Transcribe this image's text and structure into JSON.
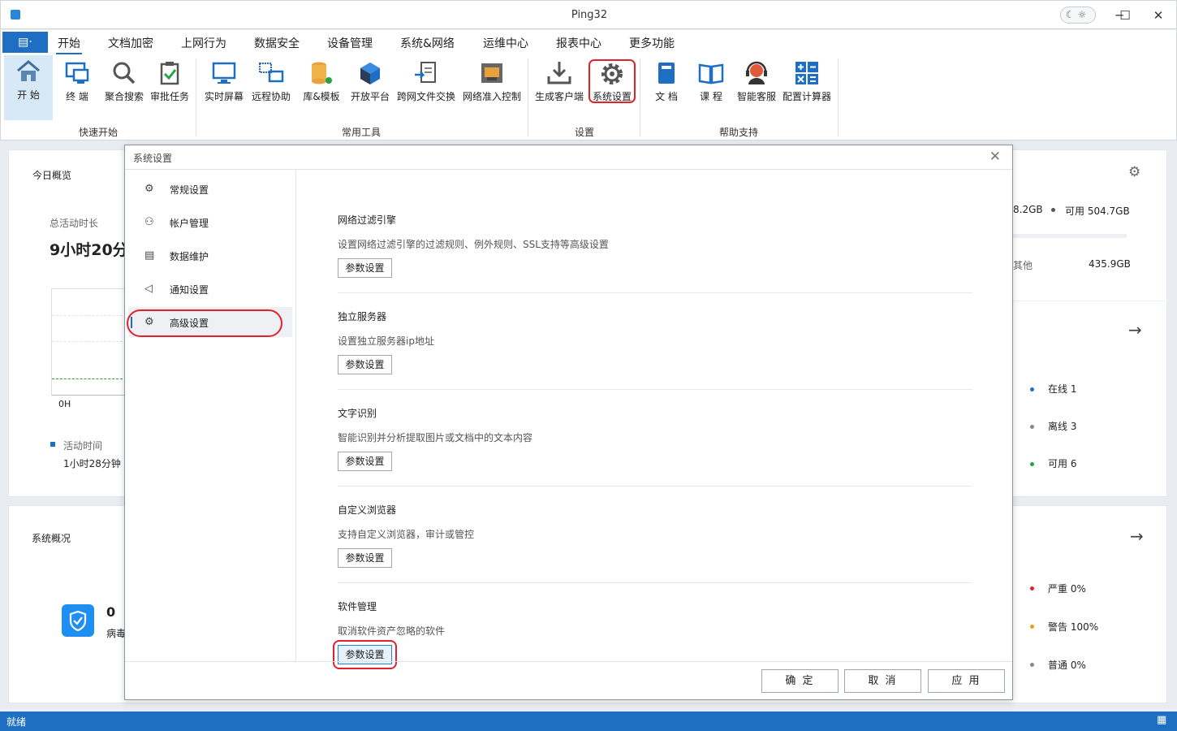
{
  "window": {
    "title": "Ping32",
    "theme_icons": "☾ ☼",
    "minimize": "─",
    "maximize": "☐",
    "close": "✕"
  },
  "menu": {
    "app_button": "▤·",
    "tabs": [
      "开始",
      "文档加密",
      "上网行为",
      "数据安全",
      "设备管理",
      "系统&网络",
      "运维中心",
      "报表中心",
      "更多功能"
    ]
  },
  "ribbon": {
    "groups": {
      "quick_start": "快速开始",
      "common_tools": "常用工具",
      "settings": "设置",
      "help": "帮助支持"
    },
    "buttons": {
      "start": "开  始",
      "terminal": "终  端",
      "search": "聚合搜索",
      "approval": "审批任务",
      "realtime": "实时屏幕",
      "remote": "远程协助",
      "library": "库&模板",
      "open_platform": "开放平台",
      "cross_net": "跨网文件交换",
      "network_access": "网络准入控制",
      "gen_client": "生成客户端",
      "sys_settings": "系统设置",
      "docs": "文  档",
      "courses": "课  程",
      "smart_service": "智能客服",
      "calculator": "配置计算器"
    }
  },
  "dashboard": {
    "today_overview": "今日概览",
    "total_active_label": "总活动时长",
    "total_active_value": "9小时20分",
    "chart_axis_label": "0H",
    "activity_legend": "活动时间",
    "activity_value": "1小时28分钟",
    "disk_used_partial": "8.2GB",
    "disk_available": "可用 504.7GB",
    "other_label": "其他",
    "other_value": "435.9GB",
    "online": "在线  1",
    "offline": "离线  3",
    "available": "可用  6",
    "system_overview": "系统概况",
    "virus_count": "0",
    "virus_label": "病毒",
    "severe": "严重  0%",
    "warning": "警告  100%",
    "normal": "普通  0%",
    "arrow": "→",
    "gear": "⚙",
    "colors": {
      "online": "#1e6ec3",
      "offline": "#888888",
      "available": "#22a447",
      "severe": "#e0222d",
      "warning": "#f39c12",
      "normal": "#888888"
    }
  },
  "dialog": {
    "title": "系统设置",
    "close": "✕",
    "nav": [
      {
        "label": "常规设置",
        "icon": "⚙"
      },
      {
        "label": "帐户管理",
        "icon": "⚇"
      },
      {
        "label": "数据维护",
        "icon": "▤"
      },
      {
        "label": "通知设置",
        "icon": "◁"
      },
      {
        "label": "高级设置",
        "icon": "⚙"
      }
    ],
    "sections": [
      {
        "title": "网络过滤引擎",
        "desc": "设置网络过滤引擎的过滤规则、例外规则、SSL支持等高级设置",
        "button": "参数设置"
      },
      {
        "title": "独立服务器",
        "desc": "设置独立服务器ip地址",
        "button": "参数设置"
      },
      {
        "title": "文字识别",
        "desc": "智能识别并分析提取图片或文档中的文本内容",
        "button": "参数设置"
      },
      {
        "title": "自定义浏览器",
        "desc": "支持自定义浏览器，审计或管控",
        "button": "参数设置"
      },
      {
        "title": "软件管理",
        "desc": "取消软件资产忽略的软件",
        "button": "参数设置"
      }
    ],
    "ok": "确 定",
    "cancel": "取 消",
    "apply": "应 用"
  },
  "statusbar": {
    "text": "就绪",
    "grip": "▦"
  }
}
